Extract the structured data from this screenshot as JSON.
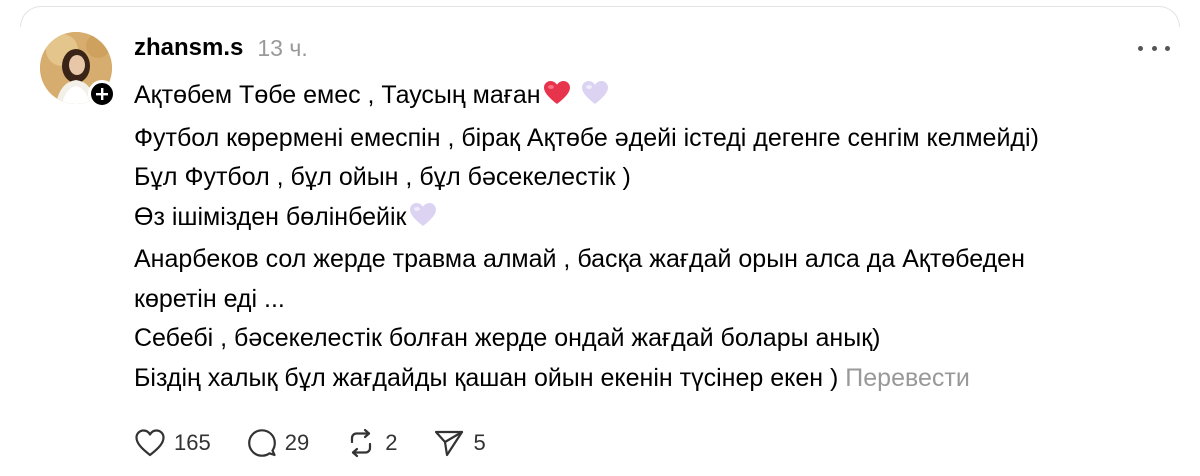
{
  "post": {
    "username": "zhansm.s",
    "time": "13 ч.",
    "lines": [
      "Ақтөбем Төбе емес , Таусың маған",
      "Футбол көрермені емеспін , бірақ Ақтөбе әдейі істеді дегенге сенгім келмейді)",
      "Бұл Футбол , бұл ойын , бұл бәсекелестік )",
      "Өз ішімізден бөлінбейік",
      "Анарбеков сол жерде травма алмай , басқа жағдай орын алса да Ақтөбеден",
      "көретін еді ...",
      "Себебі , бәсекелестік болған жерде ондай жағдай болары анық)",
      "Біздің халық бұл жағдайды қашан ойын екенін түсінер екен )"
    ],
    "translate_label": "Перевести"
  },
  "actions": {
    "likes": "165",
    "comments": "29",
    "reposts": "2",
    "shares": "5"
  },
  "icons": {
    "avatar": "avatar",
    "follow": "plus-icon",
    "more": "more-dots-icon",
    "like": "heart-outline-icon",
    "comment": "speech-bubble-icon",
    "repost": "repost-icon",
    "share": "send-icon",
    "emoji_heart_red": "red-heart-emoji",
    "emoji_heart_light": "light-purple-heart-emoji"
  },
  "colors": {
    "text": "#000000",
    "muted": "#999999",
    "heart_red": "#e8334d",
    "heart_light": "#dcd3f2"
  }
}
